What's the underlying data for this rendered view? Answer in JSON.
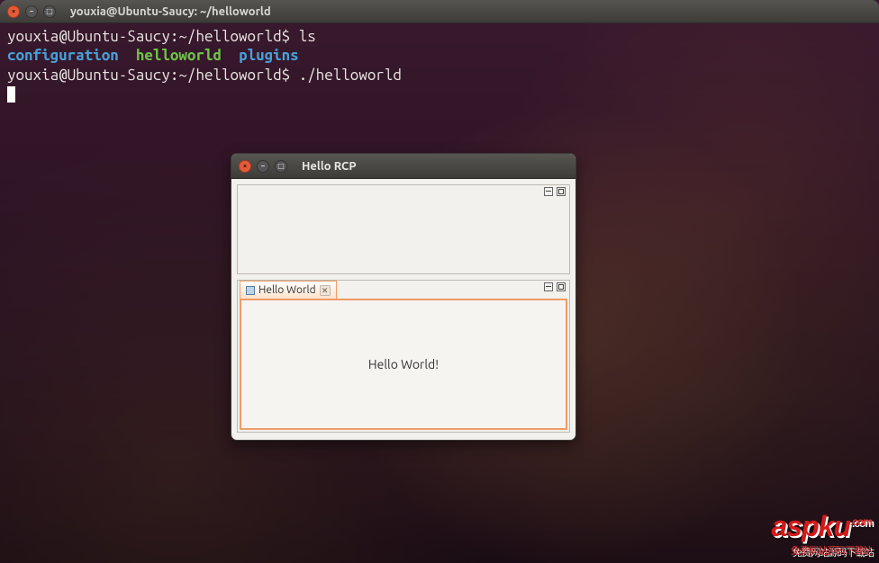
{
  "terminal": {
    "title": "youxia@Ubuntu-Saucy: ~/helloworld",
    "prompt1": "youxia@Ubuntu-Saucy:~/helloworld$ ",
    "cmd1": "ls",
    "ls_out": {
      "configuration": "configuration",
      "helloworld": "helloworld",
      "plugins": "plugins"
    },
    "prompt2": "youxia@Ubuntu-Saucy:~/helloworld$ ",
    "cmd2": "./helloworld",
    "window_buttons": {
      "close": "×",
      "min": "−",
      "max": "□"
    }
  },
  "dialog": {
    "title": "Hello RCP",
    "tab_label": "Hello World",
    "tab_close": "✕",
    "content": "Hello World!",
    "window_buttons": {
      "close": "×",
      "min": "−",
      "max": "□"
    }
  },
  "watermark": {
    "brand": "aspku",
    "tld": ".com",
    "subtitle": "免费网站源码下载站"
  }
}
